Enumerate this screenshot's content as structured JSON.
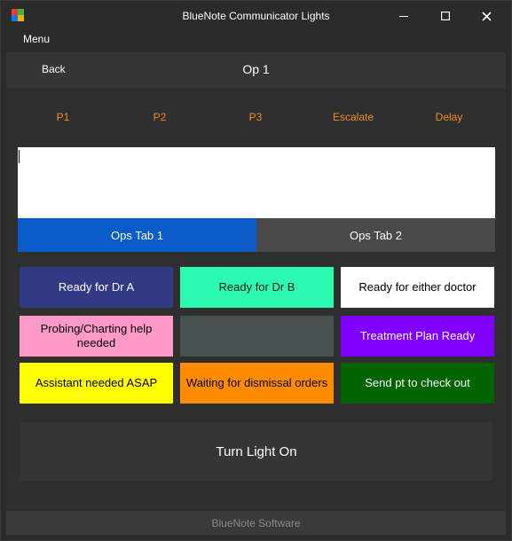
{
  "window": {
    "title": "BlueNote Communicator Lights",
    "icon_colors": [
      "#e8402a",
      "#3bb44a",
      "#1a73e8",
      "#f2b400"
    ]
  },
  "menu": {
    "label": "Menu"
  },
  "nav": {
    "back_label": "Back",
    "title": "Op 1"
  },
  "top_links": [
    {
      "label": "P1"
    },
    {
      "label": "P2"
    },
    {
      "label": "P3"
    },
    {
      "label": "Escalate"
    },
    {
      "label": "Delay"
    }
  ],
  "message": {
    "value": ""
  },
  "tabs": [
    {
      "label": "Ops Tab 1",
      "active": true
    },
    {
      "label": "Ops Tab 2",
      "active": false
    }
  ],
  "lights": [
    {
      "label": "Ready for Dr A",
      "bg": "#323a86",
      "fg": "#ffffff"
    },
    {
      "label": "Ready for Dr B",
      "bg": "#2bfbb0",
      "fg": "#1a1a1a"
    },
    {
      "label": "Ready for either doctor",
      "bg": "#ffffff",
      "fg": "#000000"
    },
    {
      "label": "Probing/Charting help needed",
      "bg": "#ff9ac8",
      "fg": "#000000"
    },
    {
      "label": "",
      "bg": "#465150",
      "fg": "#ffffff"
    },
    {
      "label": "Treatment Plan Ready",
      "bg": "#7f00ff",
      "fg": "#ffffff"
    },
    {
      "label": "Assistant needed ASAP",
      "bg": "#ffff00",
      "fg": "#000000"
    },
    {
      "label": "Waiting for dismissal orders",
      "bg": "#ff8c00",
      "fg": "#000000"
    },
    {
      "label": "Send pt to check out",
      "bg": "#006400",
      "fg": "#ffffff"
    }
  ],
  "turn_on": {
    "label": "Turn Light On"
  },
  "footer": {
    "text": "BlueNote Software"
  },
  "colors": {
    "accent_orange": "#f28c1c",
    "tab_active": "#0a5cc8"
  }
}
